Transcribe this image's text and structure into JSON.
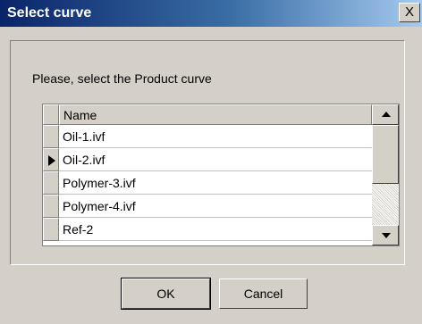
{
  "window": {
    "title": "Select curve",
    "close_glyph": "X"
  },
  "dialog": {
    "prompt": "Please, select the Product curve",
    "grid": {
      "column_header": "Name",
      "rows": [
        "Oil-1.ivf",
        "Oil-2.ivf",
        "Polymer-3.ivf",
        "Polymer-4.ivf",
        "Ref-2"
      ],
      "selected_row_index": 1
    },
    "buttons": {
      "ok": "OK",
      "cancel": "Cancel"
    }
  }
}
